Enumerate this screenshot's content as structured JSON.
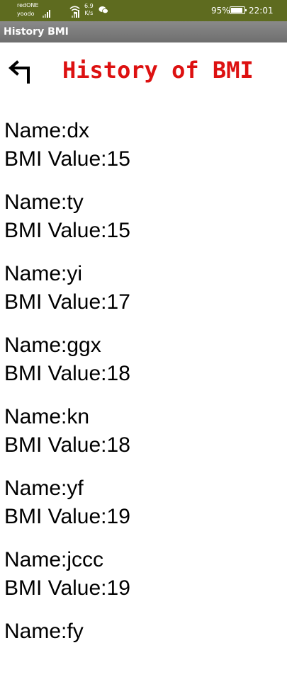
{
  "status_bar": {
    "carrier_line1": "redONE",
    "carrier_line2": "yoodo",
    "speed_value": "6.9",
    "speed_unit": "K/s",
    "battery": "95%",
    "battery_level": 0.95,
    "time": "22:01",
    "icons": [
      "signal-icon",
      "signal-icon",
      "wifi-icon",
      "wechat-icon",
      "battery-icon"
    ]
  },
  "app_bar": {
    "title": "History BMI"
  },
  "header": {
    "back_icon": "back-arrow-icon",
    "heading": "History of BMI"
  },
  "colors": {
    "status_bar_bg": "#5e6b1f",
    "app_bar_bg": "#7a7a7a",
    "heading": "#dd1111",
    "text": "#000000",
    "background": "#ffffff"
  },
  "records": [
    {
      "name": "Name:dx",
      "bmi": "BMI Value:15"
    },
    {
      "name": "Name:ty",
      "bmi": "BMI Value:15"
    },
    {
      "name": "Name:yi",
      "bmi": "BMI Value:17"
    },
    {
      "name": "Name:ggx",
      "bmi": "BMI Value:18"
    },
    {
      "name": "Name:kn",
      "bmi": "BMI Value:18"
    },
    {
      "name": "Name:yf",
      "bmi": "BMI Value:19"
    },
    {
      "name": "Name:jccc",
      "bmi": "BMI Value:19"
    },
    {
      "name": "Name:fy",
      "bmi": ""
    }
  ]
}
